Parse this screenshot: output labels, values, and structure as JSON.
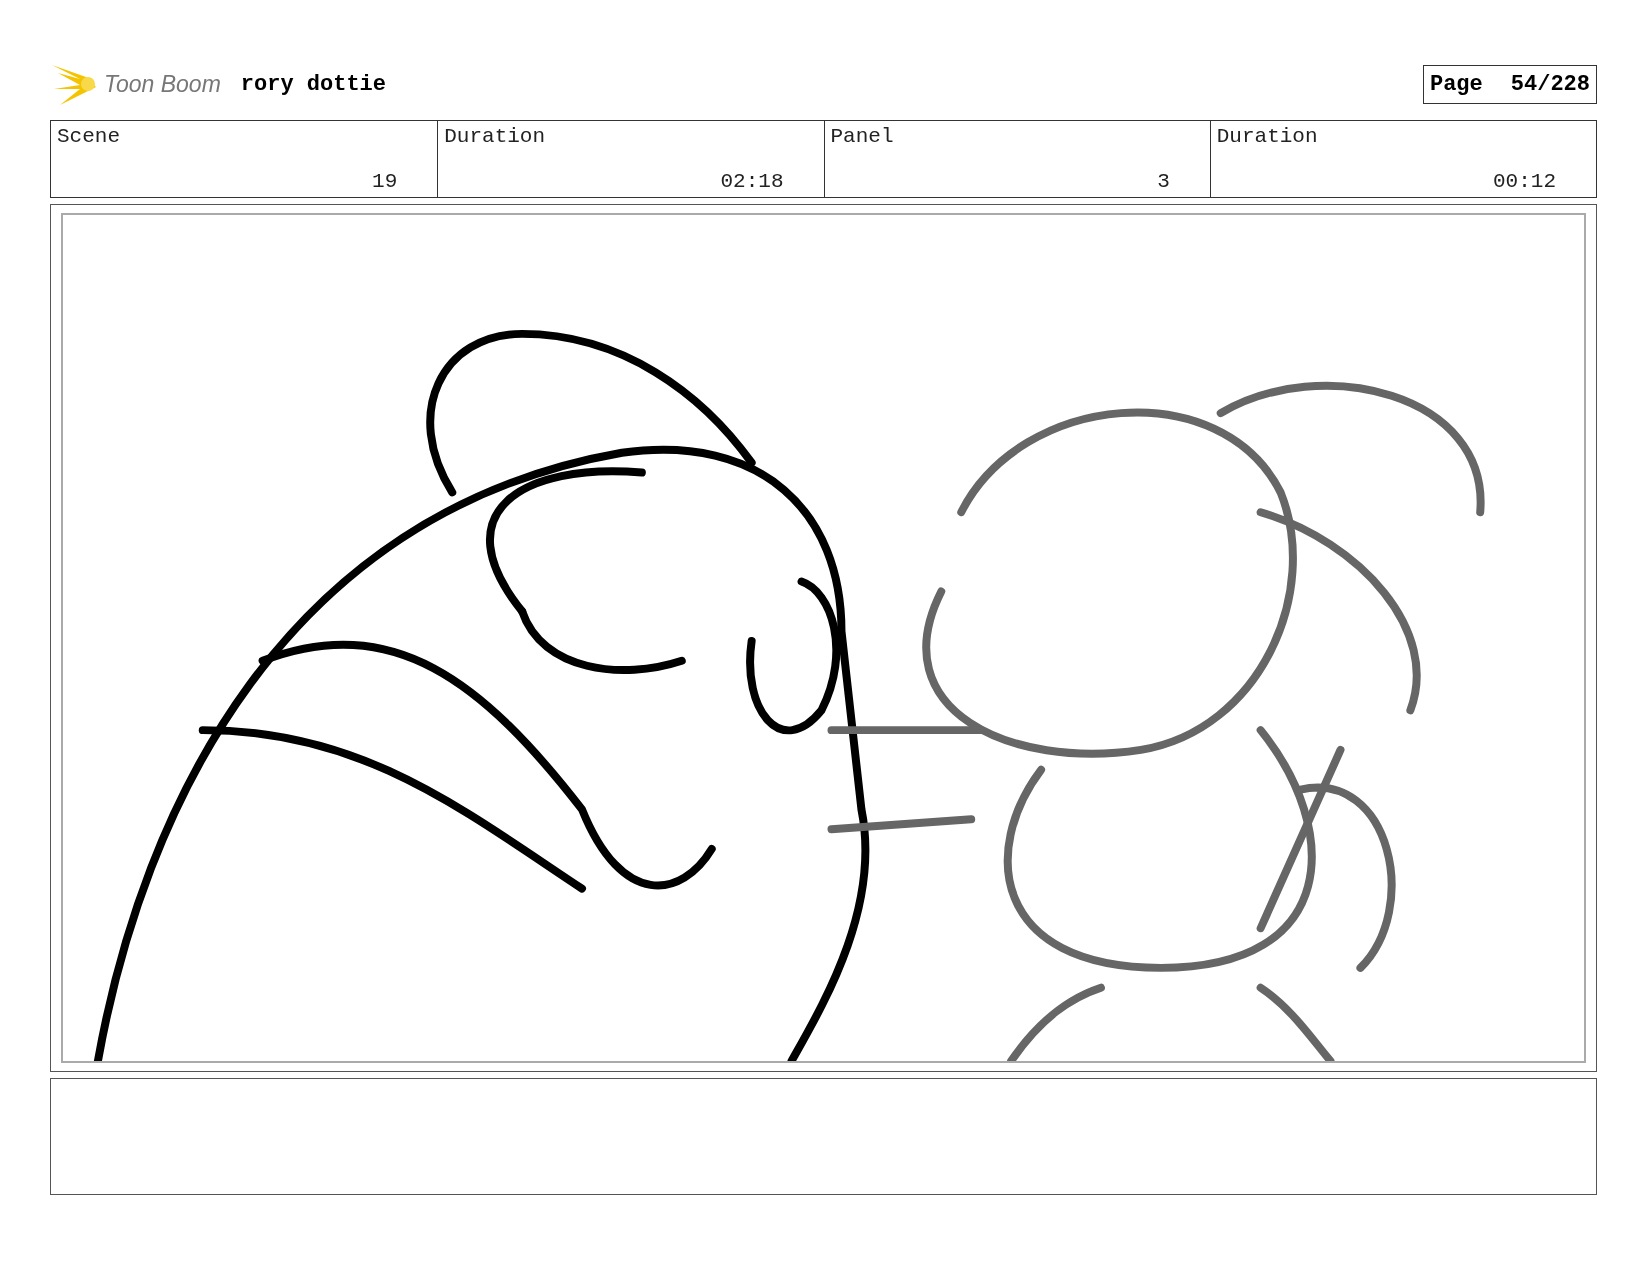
{
  "header": {
    "logo_text": "Toon Boom",
    "project": "rory dottie",
    "page_label": "Page",
    "page_number": "54/228"
  },
  "info": [
    {
      "label": "Scene",
      "value": "19"
    },
    {
      "label": "Duration",
      "value": "02:18"
    },
    {
      "label": "Panel",
      "value": "3"
    },
    {
      "label": "Duration",
      "value": "00:12"
    }
  ]
}
